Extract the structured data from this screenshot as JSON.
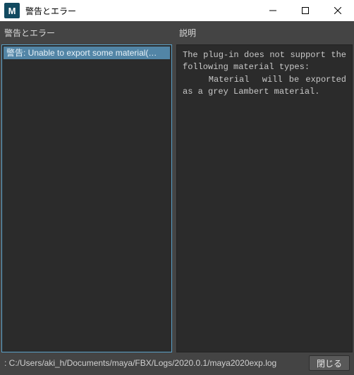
{
  "titlebar": {
    "icon_letter": "M",
    "title": "警告とエラー"
  },
  "left": {
    "header": "警告とエラー",
    "items": [
      "警告: Unable to export some material(…"
    ]
  },
  "right": {
    "header": "説明",
    "description": "The plug-in does not support the following material types:\n    Material  will be exported as a grey Lambert material."
  },
  "status": {
    "text": ": C:/Users/aki_h/Documents/maya/FBX/Logs/2020.0.1/maya2020exp.log",
    "close_label": "閉じる"
  }
}
